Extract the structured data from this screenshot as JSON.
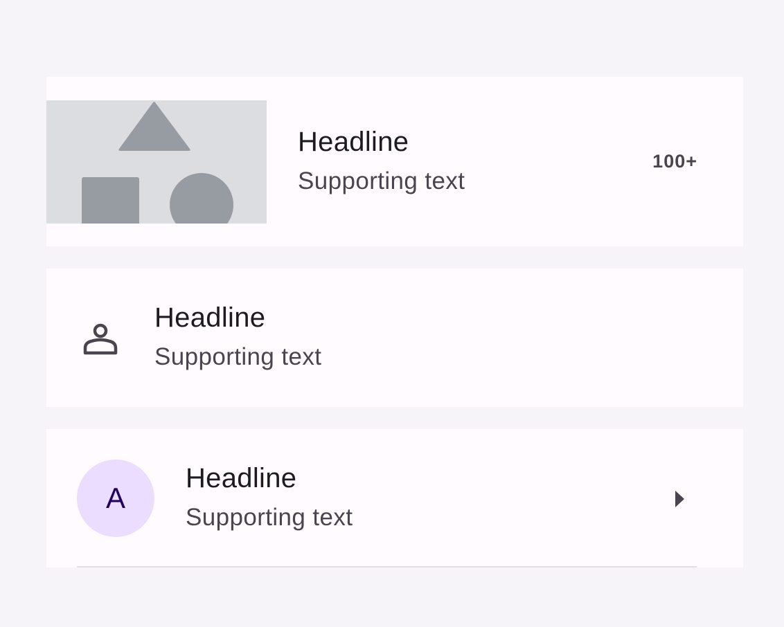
{
  "list": {
    "items": [
      {
        "headline": "Headline",
        "supporting_text": "Supporting text",
        "leading": "image-thumbnail",
        "trailing_text": "100+"
      },
      {
        "headline": "Headline",
        "supporting_text": "Supporting text",
        "leading": "person-icon"
      },
      {
        "headline": "Headline",
        "supporting_text": "Supporting text",
        "leading": "avatar",
        "avatar_letter": "A",
        "trailing": "arrow-right-icon"
      }
    ]
  },
  "colors": {
    "page_background": "#F6F3F9",
    "item_background": "#FFFBFE",
    "headline": "#1C1B1F",
    "supporting": "#49454F",
    "avatar_background": "#EADDFF",
    "avatar_text": "#21005D",
    "thumbnail_background": "#DCDDE1",
    "thumbnail_shapes": "#979CA3"
  }
}
